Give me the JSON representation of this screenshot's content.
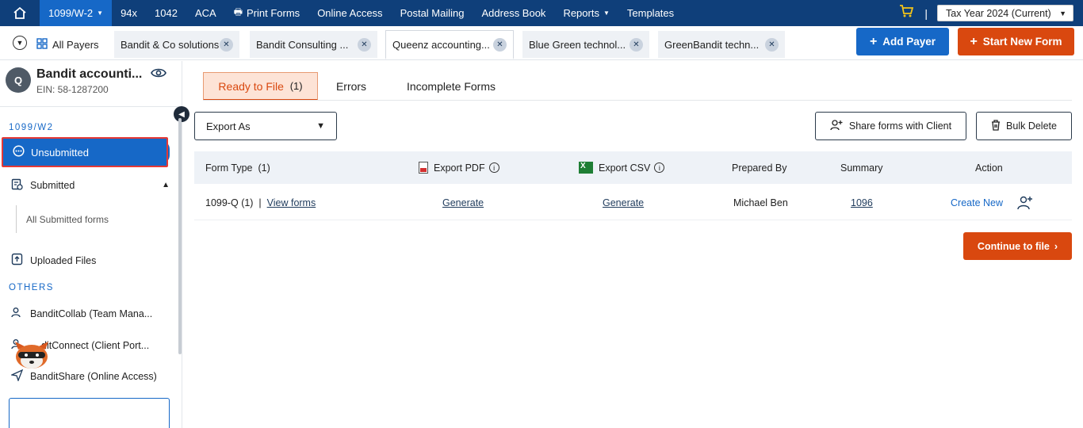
{
  "topnav": {
    "items": [
      {
        "label": "1099/W-2",
        "caret": "▼",
        "active": true
      },
      {
        "label": "94x"
      },
      {
        "label": "1042"
      },
      {
        "label": "ACA"
      },
      {
        "label": "Print Forms",
        "icon": "printer-icon"
      },
      {
        "label": "Online Access"
      },
      {
        "label": "Postal Mailing"
      },
      {
        "label": "Address Book"
      },
      {
        "label": "Reports",
        "caret": "▼"
      },
      {
        "label": "Templates"
      }
    ],
    "tax_year": "Tax Year 2024 (Current)",
    "separator": "|"
  },
  "tabbar": {
    "all_payers": "All Payers",
    "tabs": [
      {
        "label": "Bandit & Co solutions"
      },
      {
        "label": "Bandit Consulting ..."
      },
      {
        "label": "Queenz accounting...",
        "active": true
      },
      {
        "label": "Blue Green technol..."
      },
      {
        "label": "GreenBandit techn..."
      }
    ],
    "add_payer": "Add Payer",
    "start_new_form": "Start New Form"
  },
  "sidebar": {
    "avatar_initial": "Q",
    "payer_name": "Bandit accounti...",
    "ein": "EIN: 58-1287200",
    "section1": "1099/W2",
    "unsubmitted": "Unsubmitted",
    "submitted": "Submitted",
    "all_submitted": "All Submitted forms",
    "uploaded": "Uploaded Files",
    "section2": "OTHERS",
    "collab": "BanditCollab (Team Mana...",
    "connect": "ditConnect (Client Port...",
    "share": "BanditShare (Online Access)"
  },
  "main": {
    "tabs": {
      "ready": "Ready to File",
      "ready_count": "(1)",
      "errors": "Errors",
      "incomplete": "Incomplete Forms"
    },
    "export_as": "Export As",
    "share_client": "Share forms with Client",
    "bulk_delete": "Bulk Delete",
    "table": {
      "headers": {
        "form_type": "Form Type",
        "form_type_count": "(1)",
        "export_pdf": "Export PDF",
        "export_csv": "Export CSV",
        "prepared_by": "Prepared By",
        "summary": "Summary",
        "action": "Action"
      },
      "rows": [
        {
          "form": "1099-Q",
          "count": "(1)",
          "sep": "|",
          "view": "View forms",
          "pdf": "Generate",
          "csv": "Generate",
          "prepared_by": "Michael Ben",
          "summary": "1096",
          "action": "Create New"
        }
      ]
    },
    "continue": "Continue to file"
  }
}
